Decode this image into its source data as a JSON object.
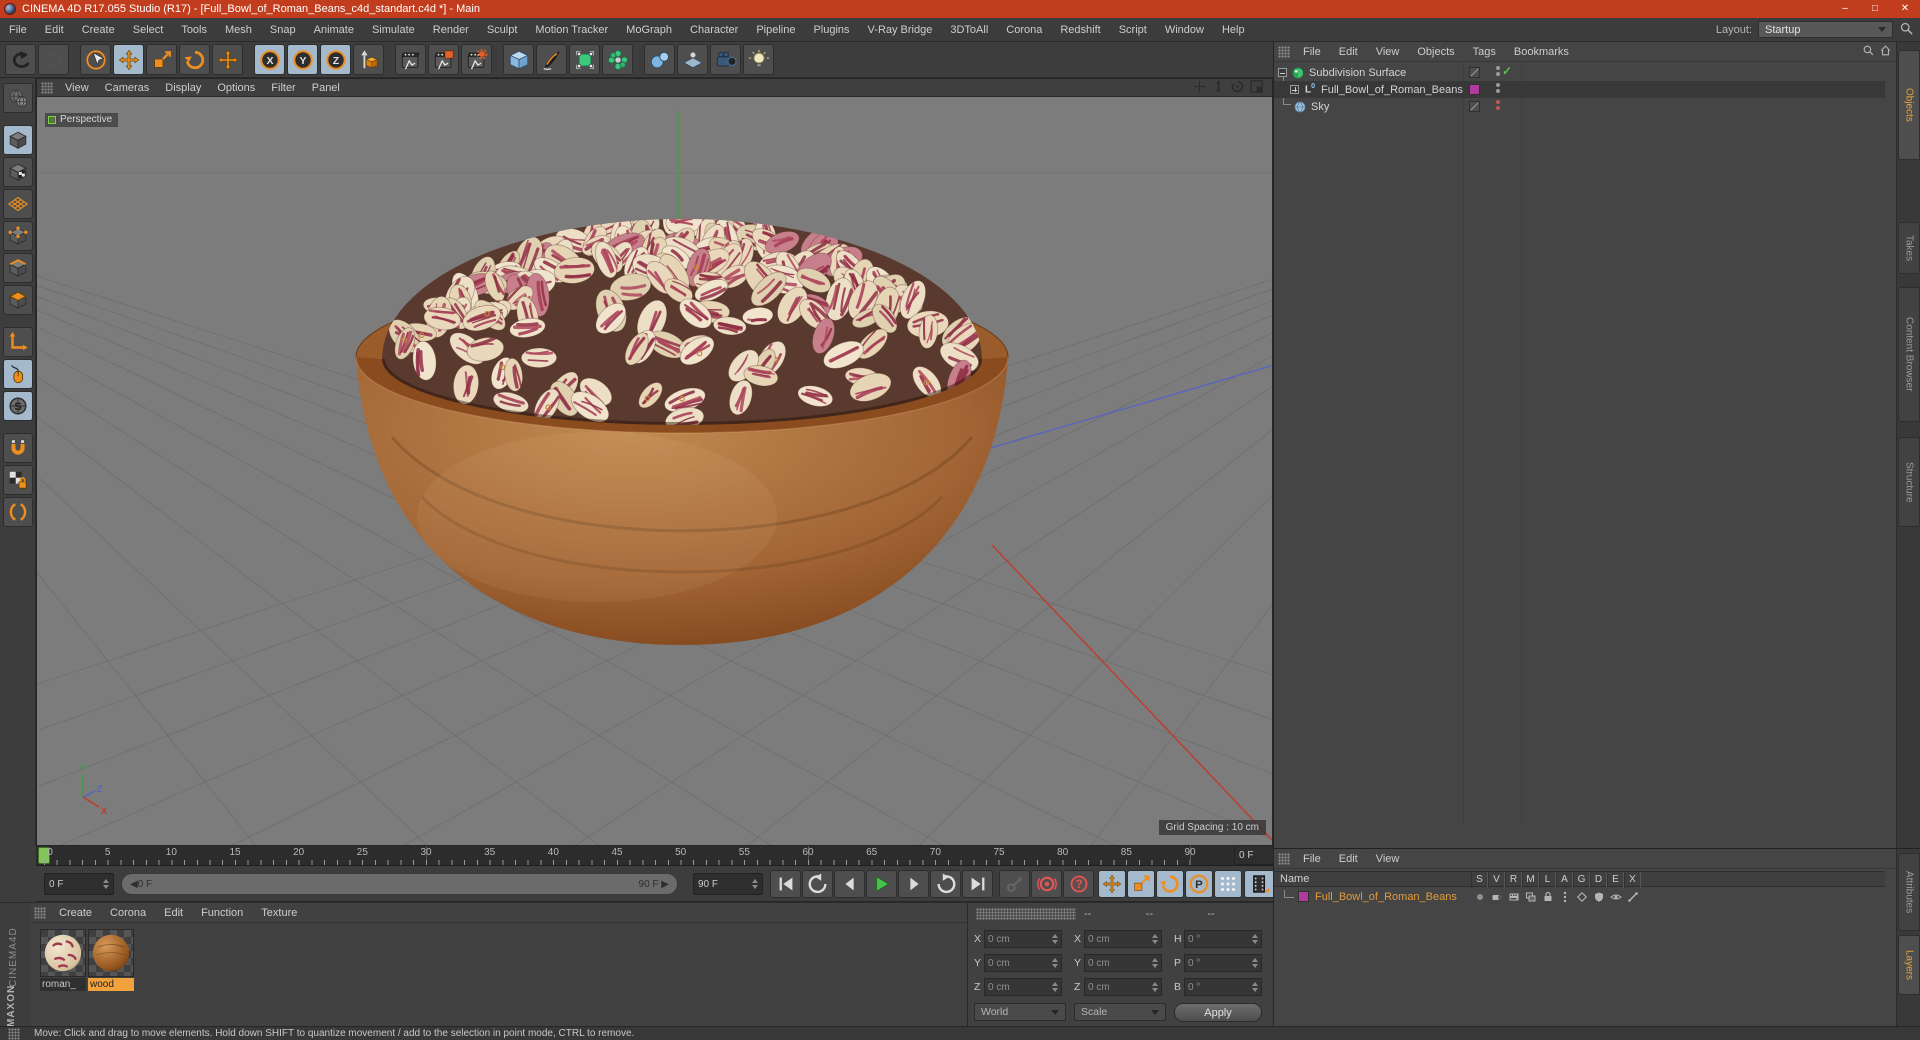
{
  "window": {
    "title": "CINEMA 4D R17.055 Studio (R17) - [Full_Bowl_of_Roman_Beans_c4d_standart.c4d *] - Main",
    "controls": {
      "minimize": "–",
      "maximize": "□",
      "close": "✕"
    }
  },
  "menu_bar": {
    "items": [
      "File",
      "Edit",
      "Create",
      "Select",
      "Tools",
      "Mesh",
      "Snap",
      "Animate",
      "Simulate",
      "Render",
      "Sculpt",
      "Motion Tracker",
      "MoGraph",
      "Character",
      "Pipeline",
      "Plugins",
      "V-Ray Bridge",
      "3DToAll",
      "Corona",
      "Redshift",
      "Script",
      "Window",
      "Help"
    ],
    "layout_label": "Layout:",
    "layout_value": "Startup"
  },
  "toolbar": {
    "buttons": [
      {
        "name": "undo",
        "icon": "undo"
      },
      {
        "name": "redo",
        "icon": "redo",
        "disabled": true
      },
      {
        "sep": true
      },
      {
        "name": "live-selection",
        "icon": "select"
      },
      {
        "name": "move",
        "icon": "move",
        "active": true
      },
      {
        "name": "scale",
        "icon": "scale"
      },
      {
        "name": "rotate",
        "icon": "rotate"
      },
      {
        "name": "last-used-tool",
        "icon": "move"
      },
      {
        "sep": true
      },
      {
        "name": "lock-x-axis",
        "icon": "axis",
        "label": "X",
        "active": true
      },
      {
        "name": "lock-y-axis",
        "icon": "axis",
        "label": "Y",
        "active": true
      },
      {
        "name": "lock-z-axis",
        "icon": "axis",
        "label": "Z",
        "active": true
      },
      {
        "name": "coordinate-system",
        "icon": "coordsys"
      },
      {
        "sep": true
      },
      {
        "name": "render-view",
        "icon": "renderView"
      },
      {
        "name": "render-picture-viewer",
        "icon": "renderPV"
      },
      {
        "name": "render-settings",
        "icon": "renderSet"
      },
      {
        "sep": true
      },
      {
        "name": "primitive-cube",
        "icon": "cube"
      },
      {
        "name": "spline-pen",
        "icon": "pen"
      },
      {
        "name": "subdivision-surface",
        "icon": "subdiv"
      },
      {
        "name": "cloner-objects",
        "icon": "cluster"
      },
      {
        "sep": true
      },
      {
        "name": "metaball",
        "icon": "metaball"
      },
      {
        "name": "floor-environment",
        "icon": "floor"
      },
      {
        "name": "camera",
        "icon": "camera"
      },
      {
        "name": "light",
        "icon": "light"
      }
    ]
  },
  "left_palette": {
    "buttons": [
      {
        "name": "make-editable",
        "icon": "globe"
      },
      {
        "gap": true
      },
      {
        "name": "model-mode",
        "icon": "cubeModel",
        "active": true
      },
      {
        "name": "texture-mode",
        "icon": "cubeTexture"
      },
      {
        "name": "workplane-mode",
        "icon": "workplane"
      },
      {
        "name": "points-mode",
        "icon": "cubePoints"
      },
      {
        "name": "edges-mode",
        "icon": "cubeEdges"
      },
      {
        "name": "polygons-mode",
        "icon": "cubePolys"
      },
      {
        "gap": true
      },
      {
        "name": "axis-mode",
        "icon": "axisL"
      },
      {
        "name": "mouse-mode",
        "icon": "mouse",
        "active": true
      },
      {
        "name": "simulation-mode",
        "icon": "sbadge",
        "active": true
      },
      {
        "gap": true
      },
      {
        "name": "snap-magnet",
        "icon": "magnet"
      },
      {
        "name": "workplane-lock",
        "icon": "checkerlock"
      },
      {
        "name": "snap-rings",
        "icon": "rings"
      }
    ]
  },
  "viewport": {
    "menu": [
      "View",
      "Cameras",
      "Display",
      "Options",
      "Filter",
      "Panel"
    ],
    "label": "Perspective",
    "grid_spacing": "Grid Spacing : 10 cm",
    "nav_icons": [
      "pan",
      "dolly",
      "orbit",
      "maximize"
    ],
    "axis_labels": {
      "x": "X",
      "y": "Y",
      "z": "Z"
    }
  },
  "timeline": {
    "frame_labels": [
      0,
      5,
      10,
      15,
      20,
      25,
      30,
      35,
      40,
      45,
      50,
      55,
      60,
      65,
      70,
      75,
      80,
      85,
      90
    ],
    "frames_total": 90,
    "playhead_frame": 0,
    "current_frame": "0 F",
    "range_start": "0 F",
    "range_end": "90 F",
    "end_frame": "90 F"
  },
  "transport": {
    "buttons": [
      "goto-start",
      "play-backward",
      "previous-frame",
      "play-forward",
      "next-frame",
      "play-loop",
      "goto-end"
    ],
    "record_buttons": [
      "record-keyframe",
      "autokeying",
      "keyframe-selection"
    ],
    "toggle_buttons": [
      "record-position",
      "record-scale",
      "record-rotation",
      "record-parameter",
      "record-point-level"
    ],
    "film_button": "keyframe-selection-filter"
  },
  "materials_panel": {
    "menu": [
      "Create",
      "Corona",
      "Edit",
      "Function",
      "Texture"
    ],
    "items": [
      {
        "name": "roman_",
        "kind": "beans",
        "selected": false
      },
      {
        "name": "wood",
        "kind": "wood",
        "selected": true
      }
    ]
  },
  "brand": {
    "vertical": "CINEMA4D",
    "bottom": "MAXON"
  },
  "coordinates_panel": {
    "handle_headers": [
      "--",
      "--",
      "--"
    ],
    "position": {
      "labels": [
        "X",
        "Y",
        "Z"
      ],
      "values": [
        "0 cm",
        "0 cm",
        "0 cm"
      ]
    },
    "size": {
      "labels": [
        "X",
        "Y",
        "Z"
      ],
      "values": [
        "0 cm",
        "0 cm",
        "0 cm"
      ]
    },
    "rotation": {
      "labels": [
        "H",
        "P",
        "B"
      ],
      "values": [
        "0 °",
        "0 °",
        "0 °"
      ]
    },
    "space_dropdown": "World",
    "mode_dropdown": "Scale",
    "apply_label": "Apply"
  },
  "object_manager": {
    "menu": [
      "File",
      "Edit",
      "View",
      "Objects",
      "Tags",
      "Bookmarks"
    ],
    "objects": [
      {
        "name": "Subdivision Surface",
        "icon": "subdiv-sphere",
        "expander": "minus",
        "chip": "slash",
        "dots": "gray",
        "check": true,
        "indent": 0
      },
      {
        "name": "Full_Bowl_of_Roman_Beans",
        "icon": "axis-null",
        "expander": "plus",
        "chip": "#b13a9e",
        "dots": "gray",
        "selected": true,
        "indent": 1
      },
      {
        "name": "Sky",
        "icon": "sky-globe",
        "expander": "none",
        "chip": "slash",
        "dots": "red",
        "indent": 0
      }
    ],
    "side_tabs": [
      {
        "label": "Objects",
        "active": true
      },
      {
        "label": "Takes",
        "active": false
      },
      {
        "label": "Content Browser",
        "active": false
      },
      {
        "label": "Structure",
        "active": false
      }
    ]
  },
  "lower_panel": {
    "menu": [
      "File",
      "Edit",
      "View"
    ],
    "name_header": "Name",
    "columns": [
      "S",
      "V",
      "R",
      "M",
      "L",
      "A",
      "G",
      "D",
      "E",
      "X"
    ],
    "rows": [
      {
        "name": "Full_Bowl_of_Roman_Beans",
        "chip": "#b13a9e"
      }
    ],
    "tag_icons": [
      "dot",
      "cam",
      "film",
      "layer",
      "lock",
      "dots3",
      "diamond",
      "shield",
      "eye",
      "bones"
    ],
    "side_tabs": [
      {
        "label": "Attributes",
        "active": false
      },
      {
        "label": "Layers",
        "active": true
      }
    ]
  },
  "status_bar": {
    "text": "Move: Click and drag to move elements. Hold down SHIFT to quantize movement / add to the selection in point mode, CTRL to remove."
  },
  "scene": {
    "background": "#7c7c7c",
    "grid_color": "#6e6e6e",
    "horizon_color": "#737373",
    "axis_colors": {
      "x": "#bf3b2b",
      "y": "#3fa03f",
      "z": "#5a64bd"
    },
    "bowl": {
      "wood_light": "#c08a52",
      "wood_mid": "#a26434",
      "wood_dark": "#63340f",
      "rim": "#9a5c2a",
      "interior": "#42260f",
      "band": "#8a4c1e",
      "mound_base": "#5a3a2e"
    },
    "beans": {
      "count": 175,
      "cream_colors": [
        "#ecdfc6",
        "#e6d5b5",
        "#f0e4cd",
        "#dfd0b0",
        "#e9d8bb"
      ],
      "streak_colors": [
        "#a63d55",
        "#93334a",
        "#b04a5e",
        "#8e2d42"
      ],
      "red_bean_color": "#c77f8b",
      "eye_ring_color": "#c8853c"
    }
  }
}
